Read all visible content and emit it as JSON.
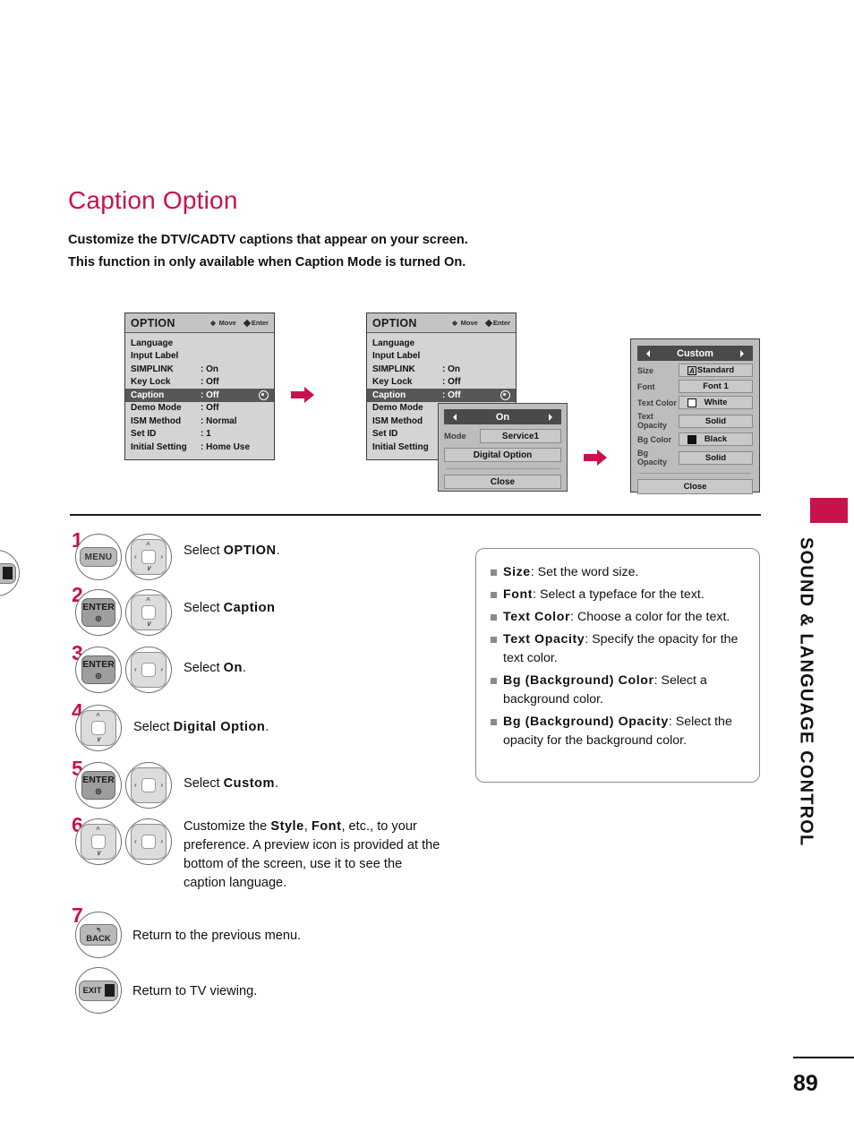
{
  "page": {
    "title": "Caption Option",
    "intro_line1": "Customize the DTV/CADTV captions that appear on your screen.",
    "intro_line2": "This function in only available when Caption Mode is turned On.",
    "number": "89",
    "side_label": "SOUND & LANGUAGE CONTROL",
    "accent_color": "#c8124b"
  },
  "osd": {
    "hint_move": "Move",
    "hint_enter": "Enter",
    "panel1": {
      "title": "OPTION",
      "rows": [
        {
          "label": "Language",
          "value": ""
        },
        {
          "label": "Input Label",
          "value": ""
        },
        {
          "label": "SIMPLINK",
          "value": ": On"
        },
        {
          "label": "Key Lock",
          "value": ": Off"
        },
        {
          "label": "Caption",
          "value": ": Off",
          "selected": true
        },
        {
          "label": "Demo Mode",
          "value": ": Off"
        },
        {
          "label": "ISM Method",
          "value": ": Normal"
        },
        {
          "label": "Set ID",
          "value": ": 1"
        },
        {
          "label": "Initial Setting",
          "value": ": Home Use"
        }
      ]
    },
    "panel2": {
      "title": "OPTION",
      "rows": [
        {
          "label": "Language",
          "value": ""
        },
        {
          "label": "Input Label",
          "value": ""
        },
        {
          "label": "SIMPLINK",
          "value": ": On"
        },
        {
          "label": "Key Lock",
          "value": ": Off"
        },
        {
          "label": "Caption",
          "value": ": Off",
          "selected": true
        },
        {
          "label": "Demo Mode",
          "value": ""
        },
        {
          "label": "ISM Method",
          "value": ""
        },
        {
          "label": "Set ID",
          "value": ""
        },
        {
          "label": "Initial Setting",
          "value": ""
        }
      ],
      "popup": {
        "header": "On",
        "mode_label": "Mode",
        "mode_value": "Service1",
        "digital_option": "Digital Option",
        "close": "Close"
      }
    },
    "panel3": {
      "header": "Custom",
      "rows": [
        {
          "key": "Size",
          "value": "Standard",
          "icon": "letter-a"
        },
        {
          "key": "Font",
          "value": "Font 1",
          "icon": ""
        },
        {
          "key": "Text Color",
          "value": "White",
          "icon": "swatch",
          "swatch": "#ffffff"
        },
        {
          "key": "Text Opacity",
          "value": "Solid",
          "icon": ""
        },
        {
          "key": "Bg Color",
          "value": "Black",
          "icon": "swatch",
          "swatch": "#111111"
        },
        {
          "key": "Bg Opacity",
          "value": "Solid",
          "icon": ""
        }
      ],
      "close": "Close"
    }
  },
  "steps": [
    {
      "num": "1",
      "keys": [
        "MENU",
        "pad4"
      ],
      "text_pre": "Select ",
      "text_bold": "OPTION",
      "text_post": "."
    },
    {
      "num": "2",
      "keys": [
        "ENTER",
        "padUD"
      ],
      "text_pre": "Select ",
      "text_bold": "Caption",
      "text_post": ""
    },
    {
      "num": "3",
      "keys": [
        "ENTER",
        "padLR"
      ],
      "text_pre": "Select ",
      "text_bold": "On",
      "text_post": "."
    },
    {
      "num": "4",
      "keys": [
        "padUD"
      ],
      "text_pre": "Select ",
      "text_bold": "Digital Option",
      "text_post": "."
    },
    {
      "num": "5",
      "keys": [
        "ENTER",
        "padLR"
      ],
      "text_pre": "Select ",
      "text_bold": "Custom",
      "text_post": "."
    },
    {
      "num": "6",
      "keys": [
        "padUD",
        "padLR"
      ],
      "text_pre": "Customize the ",
      "text_bold": "Style",
      "text_post": ""
    }
  ],
  "step6_text": {
    "pre": "Customize the ",
    "b1": "Style",
    "mid": ", ",
    "b2": "Font",
    "post": ", etc., to your preference. A preview icon is provided at the bottom of the screen, use it to see the caption language."
  },
  "step7": {
    "num": "7",
    "back_label": "BACK",
    "back_text": "Return to the previous menu.",
    "exit_label": "EXIT",
    "exit_text": "Return to TV viewing."
  },
  "keys": {
    "menu": "MENU",
    "enter": "ENTER"
  },
  "info_box": {
    "items": [
      {
        "term": "Size",
        "desc": ": Set the word size."
      },
      {
        "term": "Font",
        "desc": ": Select a typeface for the text."
      },
      {
        "term": "Text Color",
        "desc": ": Choose a color for the text."
      },
      {
        "term": "Text Opacity",
        "desc": ": Specify the opacity for the text color."
      },
      {
        "term": "Bg (Background) Color",
        "desc": ": Select a background color."
      },
      {
        "term": "Bg (Background) Opacity",
        "desc": ": Select the opacity for the background color."
      }
    ]
  }
}
